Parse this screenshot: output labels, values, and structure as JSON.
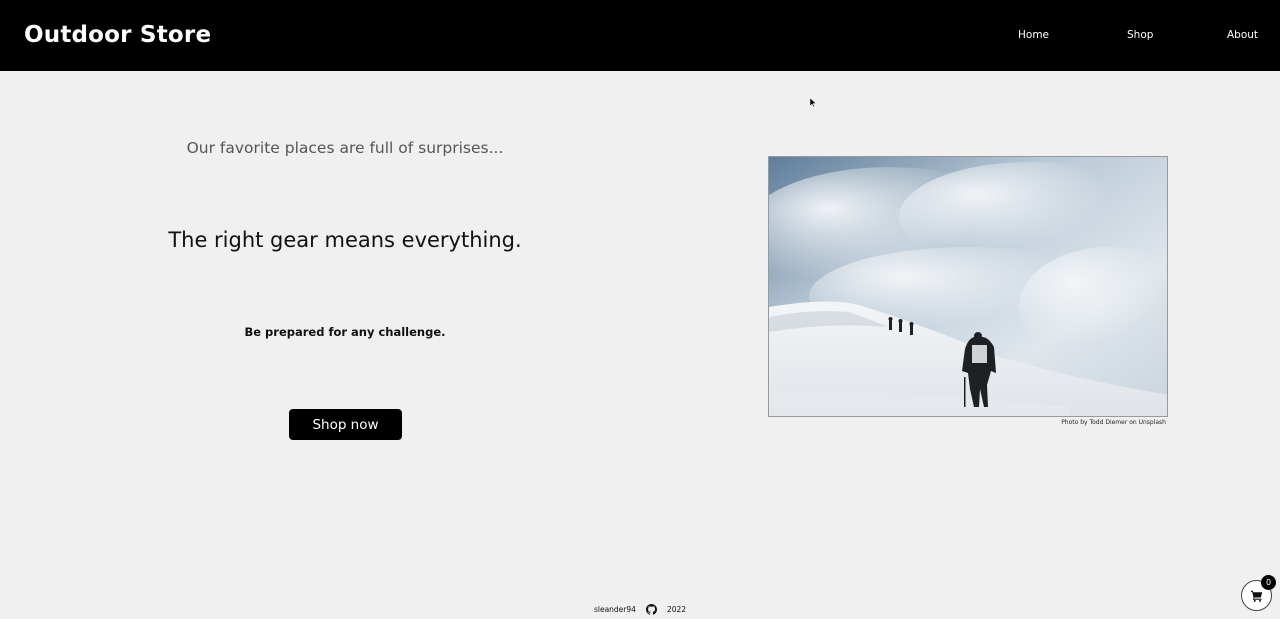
{
  "header": {
    "brand": "Outdoor Store",
    "nav": [
      {
        "label": "Home"
      },
      {
        "label": "Shop"
      },
      {
        "label": "About"
      }
    ]
  },
  "hero": {
    "tagline": "Our favorite places are full of surprises...",
    "headline": "The right gear means everything.",
    "subheadline": "Be prepared for any challenge.",
    "cta_label": "Shop now"
  },
  "photo": {
    "credit": "Photo by Todd Diemer on Unsplash"
  },
  "footer": {
    "author": "sleander94",
    "icon": "github-icon",
    "year": "2022"
  },
  "cart": {
    "count": "0",
    "icon": "cart-icon"
  },
  "colors": {
    "header_bg": "#000000",
    "page_bg": "#f0f0f0",
    "button_bg": "#000000"
  }
}
